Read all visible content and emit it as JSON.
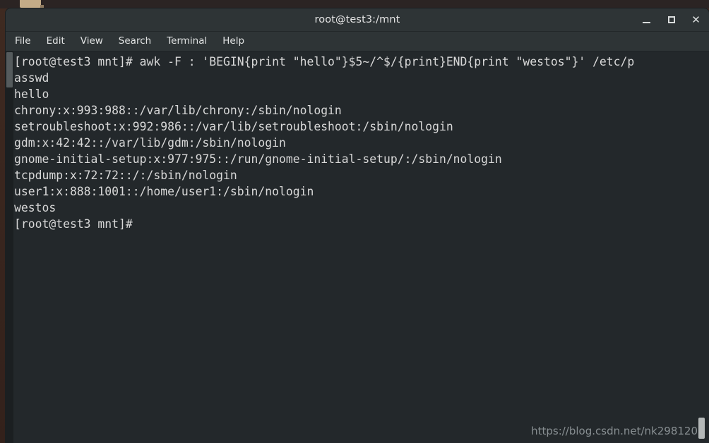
{
  "desktop": {
    "folder_icon": "folder-icon"
  },
  "window": {
    "title": "root@test3:/mnt",
    "controls": {
      "minimize": "minimize-icon",
      "maximize": "maximize-icon",
      "close": "✕"
    }
  },
  "menubar": {
    "items": [
      {
        "label": "File"
      },
      {
        "label": "Edit"
      },
      {
        "label": "View"
      },
      {
        "label": "Search"
      },
      {
        "label": "Terminal"
      },
      {
        "label": "Help"
      }
    ]
  },
  "terminal": {
    "prompt": "[root@test3 mnt]#",
    "command": "awk -F : 'BEGIN{print \"hello\"}$5~/^$/{print}END{print \"westos\"}' /etc/passwd",
    "lines": [
      "[root@test3 mnt]# awk -F : 'BEGIN{print \"hello\"}$5~/^$/{print}END{print \"westos\"}' /etc/p",
      "asswd",
      "hello",
      "chrony:x:993:988::/var/lib/chrony:/sbin/nologin",
      "setroubleshoot:x:992:986::/var/lib/setroubleshoot:/sbin/nologin",
      "gdm:x:42:42::/var/lib/gdm:/sbin/nologin",
      "gnome-initial-setup:x:977:975::/run/gnome-initial-setup/:/sbin/nologin",
      "tcpdump:x:72:72::/:/sbin/nologin",
      "user1:x:888:1001::/home/user1:/sbin/nologin",
      "westos",
      "[root@test3 mnt]#"
    ]
  },
  "watermark": {
    "text": "https://blog.csdn.net/nk298120"
  },
  "colors": {
    "terminal_background": "#23282b",
    "titlebar_background": "#2e3436",
    "terminal_text": "#d8d8d8",
    "desktop_background": "#3a2820"
  }
}
